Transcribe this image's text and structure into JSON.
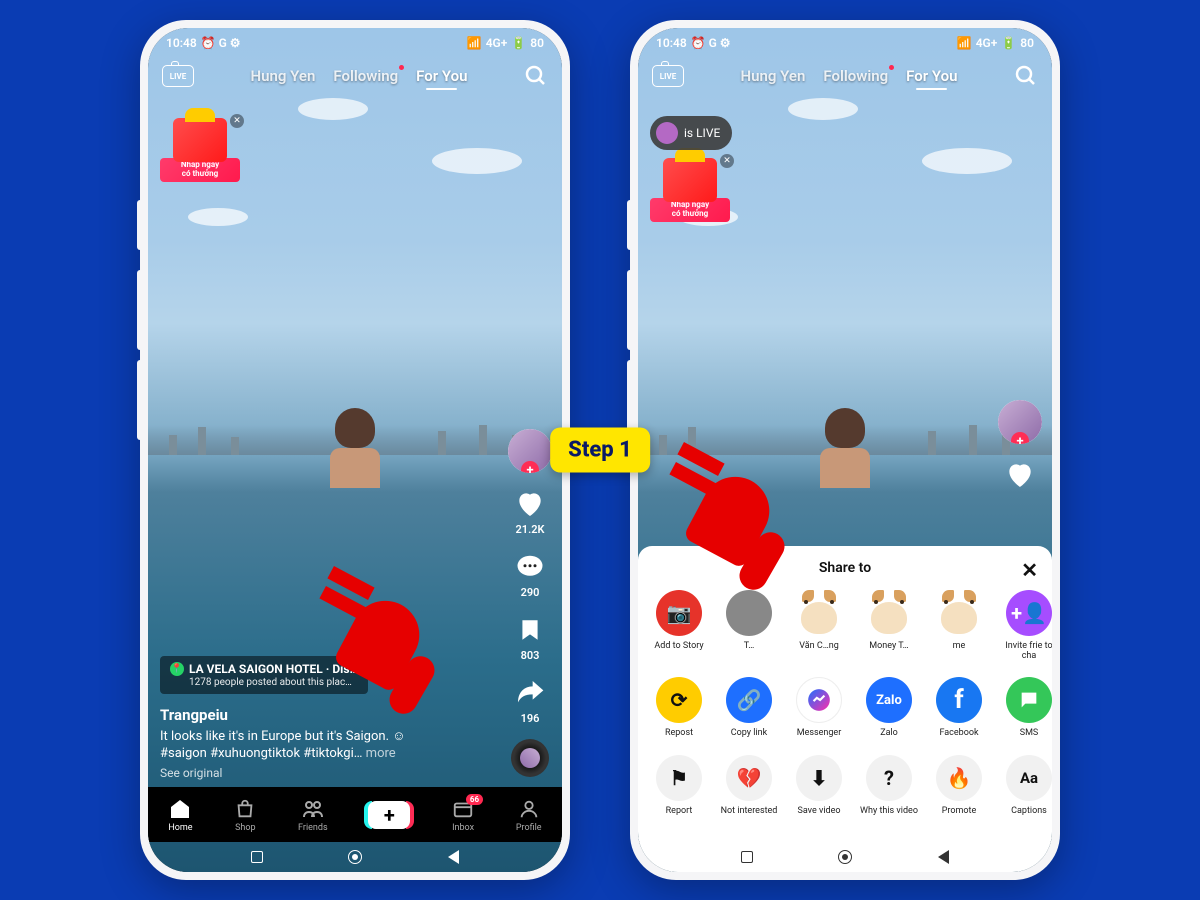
{
  "step_label": "Step 1",
  "statusbar": {
    "time": "10:48",
    "indicators": "⏰ G ⚙",
    "signal": "4G+",
    "battery": "80"
  },
  "nav": {
    "tabs": [
      "Hung Yen",
      "Following",
      "For You"
    ],
    "active": "For You",
    "live": "LIVE"
  },
  "promo": {
    "line1": "Nhấp ngay",
    "line2": "có thưởng"
  },
  "live_toast": "is LIVE",
  "location": {
    "name": "LA VELA SAIGON HOTEL · Dis…",
    "sub": "1278 people posted about this plac…"
  },
  "video": {
    "username": "Trangpeiu",
    "caption": "It looks like it's in Europe but it's Saigon. ☺",
    "hashtags": "#saigon #xuhuongtiktok #tiktokgi…",
    "more": "more",
    "see_original": "See original"
  },
  "counts": {
    "likes": "21.2K",
    "comments": "290",
    "saves": "803",
    "shares": "196"
  },
  "bottomnav": {
    "home": "Home",
    "shop": "Shop",
    "friends": "Friends",
    "inbox": "Inbox",
    "profile": "Profile",
    "badge": "66"
  },
  "share": {
    "title": "Share to",
    "row1": [
      {
        "label": "Add to Story",
        "color": "#e6332a"
      },
      {
        "label": "T…",
        "color": ""
      },
      {
        "label": "Văn C…ng",
        "color": ""
      },
      {
        "label": "Money T…",
        "color": ""
      },
      {
        "label": "me",
        "color": ""
      },
      {
        "label": "Invite frie to cha",
        "color": "#a64dff"
      }
    ],
    "row2": [
      {
        "label": "Repost",
        "color": "#ffcc00",
        "glyph": "⟳"
      },
      {
        "label": "Copy link",
        "color": "#1e6fff",
        "glyph": "🔗"
      },
      {
        "label": "Messenger",
        "color": "#ffffff",
        "glyph": "💬"
      },
      {
        "label": "Zalo",
        "color": "#1e6fff",
        "glyph": "Zalo"
      },
      {
        "label": "Facebook",
        "color": "#1877f2",
        "glyph": "f"
      },
      {
        "label": "SMS",
        "color": "#34c759",
        "glyph": "●"
      }
    ],
    "row3": [
      {
        "label": "Report",
        "glyph": "⚑"
      },
      {
        "label": "Not interested",
        "glyph": "💔"
      },
      {
        "label": "Save video",
        "glyph": "⬇"
      },
      {
        "label": "Why this video",
        "glyph": "?"
      },
      {
        "label": "Promote",
        "glyph": "🔥"
      },
      {
        "label": "Captions",
        "glyph": "Aa"
      }
    ]
  }
}
